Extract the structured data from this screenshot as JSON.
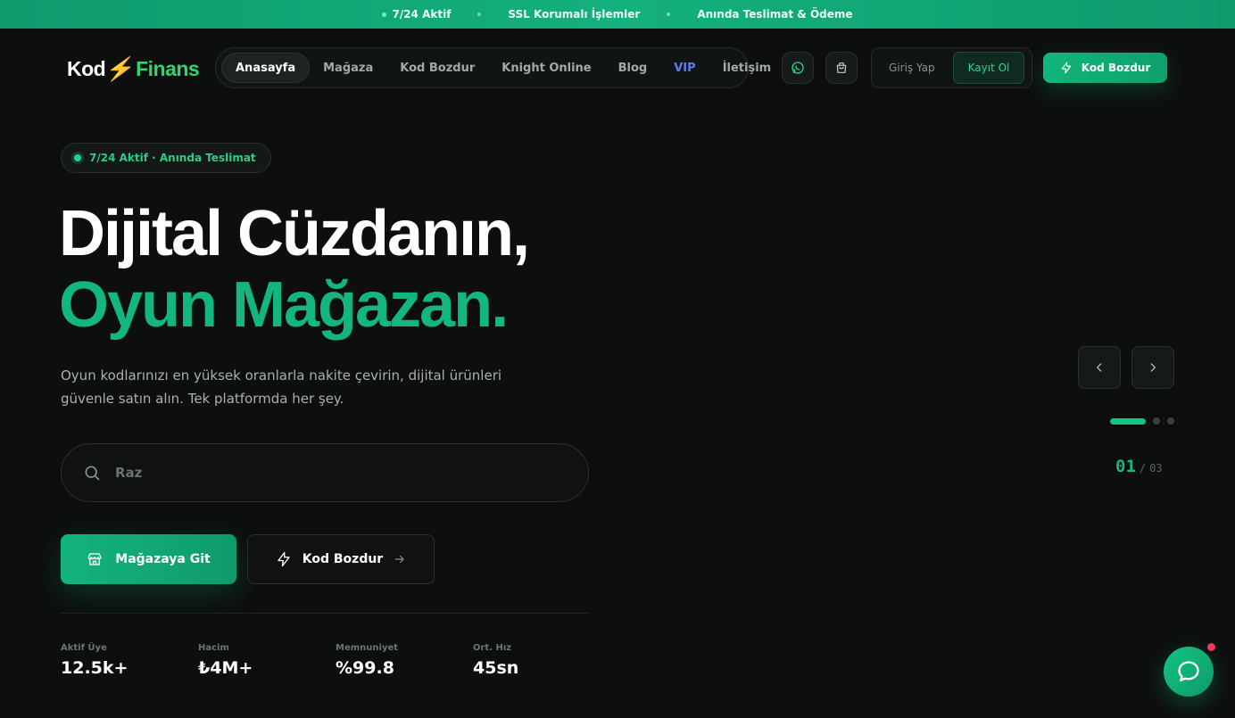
{
  "topbar": {
    "items": [
      "7/24 Aktif",
      "SSL Korumalı İşlemler",
      "Anında Teslimat & Ödeme"
    ]
  },
  "logo": {
    "part1": "Kod",
    "part2": "Finans"
  },
  "nav": {
    "items": [
      {
        "label": "Anasayfa",
        "active": true
      },
      {
        "label": "Mağaza"
      },
      {
        "label": "Kod Bozdur"
      },
      {
        "label": "Knight Online"
      },
      {
        "label": "Blog"
      },
      {
        "label": "VIP"
      },
      {
        "label": "İletişim"
      }
    ]
  },
  "header": {
    "whatsapp_icon": "whatsapp-icon",
    "cart_icon": "shopping-bag-icon",
    "login_label": "Giriş Yap",
    "register_label": "Kayıt Ol",
    "cta_label": "Kod Bozdur"
  },
  "hero": {
    "badge": "7/24 Aktif · Anında Teslimat",
    "title_line1": "Dijital Cüzdanın,",
    "title_line2": "Oyun Mağazan.",
    "description": "Oyun kodlarınızı en yüksek oranlarla nakite çevirin, dijital ürünleri güvenle satın alın. Tek platformda her şey.",
    "search_value": "Raz",
    "primary_button": "Mağazaya Git",
    "secondary_button": "Kod Bozdur"
  },
  "stats": [
    {
      "label": "Aktif Üye",
      "value": "12.5k+"
    },
    {
      "label": "Hacim",
      "value": "₺4M+"
    },
    {
      "label": "Memnuniyet",
      "value": "%99.8"
    },
    {
      "label": "Ort. Hız",
      "value": "45sn"
    }
  ],
  "slider": {
    "current": "01",
    "separator": "/",
    "total": "03",
    "active_index": 0,
    "dot_count": 3
  },
  "colors": {
    "accent": "#13b67e",
    "vip": "#5b7cf0",
    "background": "#0d0f0f"
  }
}
